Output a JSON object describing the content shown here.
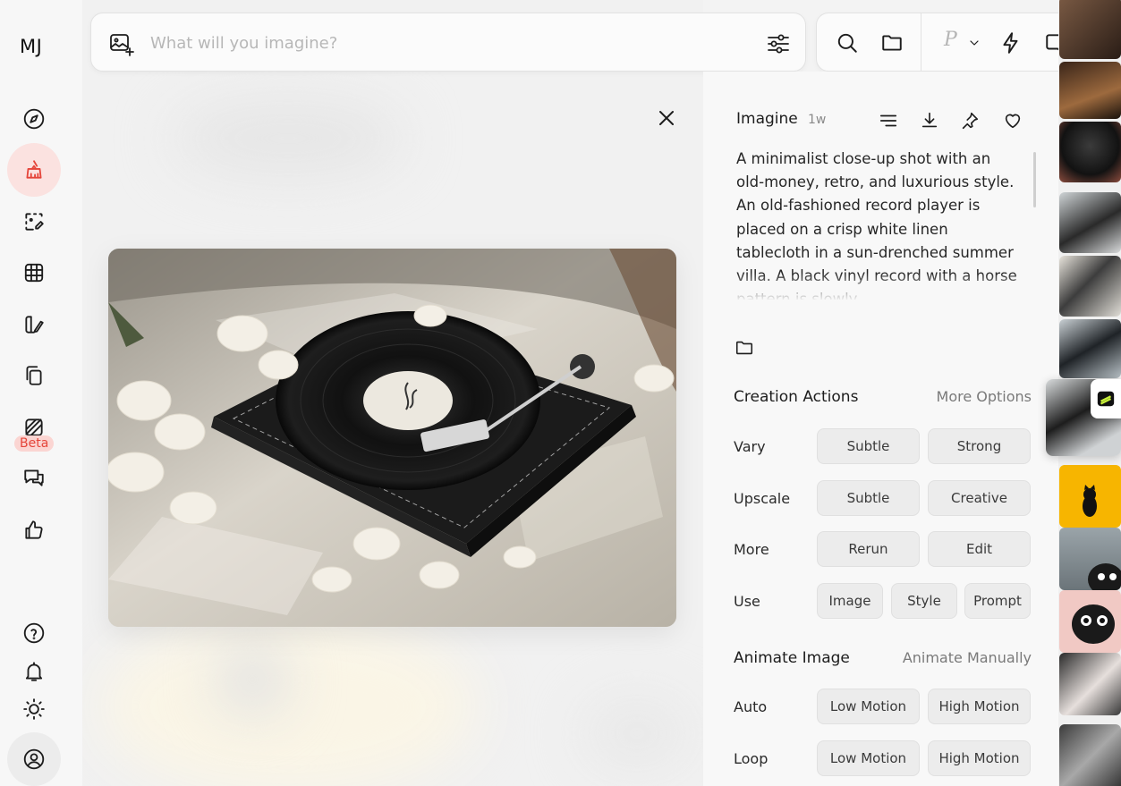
{
  "app": {
    "logo": "MJ"
  },
  "sidebar": {
    "items": [
      {
        "name": "explore",
        "icon": "compass-icon"
      },
      {
        "name": "create",
        "icon": "brush-icon",
        "active": true
      },
      {
        "name": "edit",
        "icon": "crop-edit-icon"
      },
      {
        "name": "organize",
        "icon": "grid-icon"
      },
      {
        "name": "personalize",
        "icon": "style-edit-icon"
      },
      {
        "name": "moodboards",
        "icon": "copy-icon"
      },
      {
        "name": "video",
        "icon": "video-stripes-icon",
        "badge": "Beta"
      },
      {
        "name": "chat",
        "icon": "chat-icon"
      },
      {
        "name": "rank",
        "icon": "thumbs-up-icon"
      }
    ],
    "bottom": [
      {
        "name": "help",
        "icon": "help-icon"
      },
      {
        "name": "notifications",
        "icon": "bell-icon"
      },
      {
        "name": "theme",
        "icon": "sun-icon"
      },
      {
        "name": "account",
        "icon": "user-icon"
      }
    ]
  },
  "search": {
    "placeholder": "What will you imagine?",
    "value": ""
  },
  "toolbar": {
    "personalize_letter": "P"
  },
  "detail": {
    "title": "Imagine",
    "age": "1w",
    "prompt": "A minimalist close-up shot with an old-money, retro, and luxurious style. An old-fashioned record player is placed on a crisp white linen tablecloth in a sun-drenched summer villa. A black vinyl record with a horse pattern is slowly",
    "creation_actions": {
      "title": "Creation Actions",
      "link": "More Options",
      "rows": [
        {
          "label": "Vary",
          "buttons": [
            "Subtle",
            "Strong"
          ]
        },
        {
          "label": "Upscale",
          "buttons": [
            "Subtle",
            "Creative"
          ]
        },
        {
          "label": "More",
          "buttons": [
            "Rerun",
            "Edit"
          ]
        },
        {
          "label": "Use",
          "buttons": [
            "Image",
            "Style",
            "Prompt"
          ]
        }
      ]
    },
    "animate": {
      "title": "Animate Image",
      "link": "Animate Manually",
      "rows": [
        {
          "label": "Auto",
          "buttons": [
            "Low Motion",
            "High Motion"
          ]
        },
        {
          "label": "Loop",
          "buttons": [
            "Low Motion",
            "High Motion"
          ]
        }
      ]
    }
  },
  "colors": {
    "accent": "#e5453a",
    "accent_bg": "#fbe2e0",
    "thumb_yellow": "#f7b500"
  }
}
